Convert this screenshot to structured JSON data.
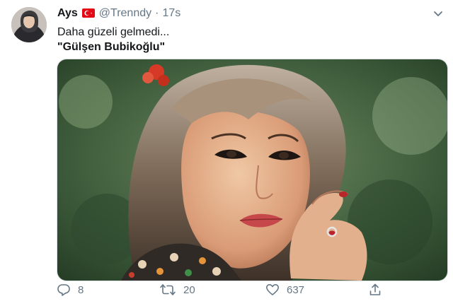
{
  "tweet": {
    "author_name": "Ays",
    "handle": "@Trenndy",
    "separator": "·",
    "time": "17s",
    "text_line1": "Daha güzeli gelmedi...",
    "text_line2": "\"Gülşen Bubikoğlu\""
  },
  "actions": {
    "reply_count": "8",
    "retweet_count": "20",
    "like_count": "637"
  },
  "icons": {
    "flag": "turkey-flag-icon",
    "menu": "chevron-down-icon",
    "reply": "reply-icon",
    "retweet": "retweet-icon",
    "like": "heart-icon",
    "share": "share-icon"
  },
  "colors": {
    "text": "#14171a",
    "secondary": "#657786",
    "flag_red": "#e30a17"
  }
}
